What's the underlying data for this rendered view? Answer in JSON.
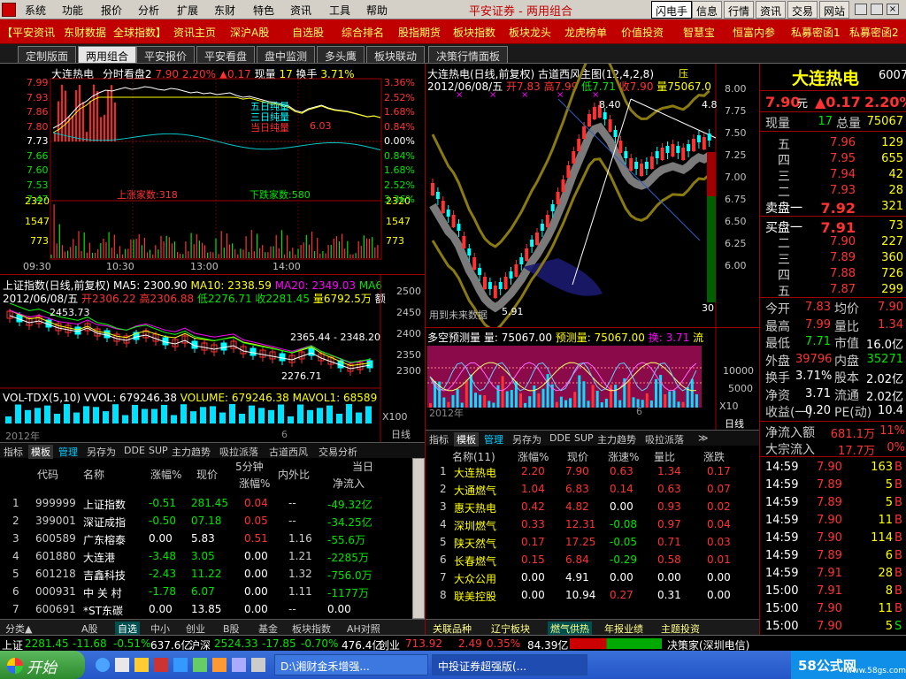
{
  "menu": {
    "items": [
      "系统",
      "功能",
      "报价",
      "分析",
      "扩展",
      "东财",
      "特色",
      "资讯",
      "工具",
      "帮助"
    ],
    "title_text": "平安证券 - 两用组合",
    "right_buttons": [
      "闪电手",
      "信息",
      "行情",
      "资讯",
      "交易",
      "网站"
    ],
    "watermark": "www.55188.com"
  },
  "linkbar": {
    "items": [
      "【平安资讯",
      "东财数据",
      "全球指数】",
      "资讯主页",
      "深沪A股",
      "自选股",
      "综合排名",
      "股指期货",
      "板块指数",
      "板块龙头",
      "龙虎榜单",
      "价值投资",
      "智慧宝",
      "恒富内参",
      "私募密函1",
      "私募密函2"
    ]
  },
  "viewtabs": [
    "定制版面",
    "两用组合",
    "平安报价",
    "平安看盘",
    "盘中监测",
    "多头鹰",
    "板块联动",
    "决策行情面板"
  ],
  "intraday": {
    "header": {
      "name": "大连热电",
      "mode": "分时看盘2",
      "price": "7.90",
      "pct": "2.20%",
      "chg": "▲0.17",
      "vol_lbl": "现量",
      "vol": "17",
      "turn_lbl": "换手",
      "turn": "3.71%"
    },
    "price_axis": [
      "7.99",
      "7.93",
      "7.86",
      "7.80",
      "7.73",
      "7.66",
      "7.60",
      "7.53",
      "7.47"
    ],
    "pct_axis": [
      "3.36%",
      "2.52%",
      "1.68%",
      "0.84%",
      "0.00%",
      "0.84%",
      "1.68%",
      "2.52%",
      "3.36%"
    ],
    "net_labels": [
      "五日纯量",
      "三日纯量",
      "当日纯量",
      "6.03"
    ],
    "up_count": "上涨家数:318",
    "down_count": "下跌家数:580",
    "vol_axis": [
      "2320",
      "1547",
      "773"
    ],
    "time_axis": [
      "09:30",
      "10:30",
      "13:00",
      "14:00"
    ]
  },
  "index_chart": {
    "header": {
      "name": "上证指数(日线,前复权)",
      "ma5": "MA5: 2300.90",
      "ma10": "MA10: 2338.59",
      "ma20": "MA20: 2349.03",
      "ma6": "MA6"
    },
    "header2": {
      "date": "2012/06/08/五",
      "open": "开2306.22",
      "high": "高2306.88",
      "low": "低2276.71",
      "close": "收2281.45",
      "amount": "量6792.5万",
      "unit": "额"
    },
    "axis": [
      "2500",
      "2450",
      "2400",
      "2350",
      "2300"
    ],
    "annot_top": "2453.73",
    "annot_mid": "2365.44 - 2348.20",
    "annot_low": "2276.71",
    "vol_header": {
      "name": "VOL-TDX(5,10)",
      "vvol": "VVOL: 679246.38",
      "volume": "VOLUME: 679246.38",
      "mavol": "MAVOL1: 68589"
    },
    "x100": "X100",
    "year": "2012年",
    "month": "6",
    "period": "日线"
  },
  "kline": {
    "header": {
      "name": "大连热电(日线,前复权)",
      "ind": "古道西风主图(12,4,2,8)",
      "pressure": "压"
    },
    "header2": {
      "date": "2012/06/08/五",
      "open": "开7.83",
      "high": "高7.99",
      "low": "低7.71",
      "close": "收7.90",
      "amount": "量75067.0"
    },
    "axis": [
      "8.00",
      "7.75",
      "7.50",
      "7.25",
      "7.00",
      "6.75",
      "6.50",
      "6.25",
      "6.00"
    ],
    "annot_high": "8.40",
    "annot_low": "5.91",
    "annot_r": "4.8",
    "future_label": "用到未来数据",
    "axis_30": "30"
  },
  "predict": {
    "header": {
      "name": "多空预测量",
      "amount": "量: 75067.00",
      "pred": "预测量: 75067.00",
      "swap": "换: 3.71",
      "flow": "流"
    },
    "axis": [
      "10000",
      "5000"
    ],
    "x10": "X10",
    "year": "2012年",
    "month": "6",
    "period": "日线"
  },
  "left_list": {
    "tabs": [
      "指标",
      "模板",
      "管理",
      "另存为",
      "DDE",
      "SUP",
      "主力趋势",
      "吸拉派落",
      "古道西风",
      "交易分析"
    ],
    "headers": [
      "代码",
      "名称",
      "涨幅%",
      "现价",
      "5分钟",
      "涨幅%",
      "内外比",
      "当日",
      "净流入"
    ],
    "rows": [
      {
        "no": "1",
        "code": "999999",
        "name": "上证指数",
        "pct": "-0.51",
        "price": "281.45",
        "m5": "0.04",
        "io": "--",
        "flow": "-49.32亿",
        "pc": "green",
        "fc": "green",
        "mc": "red"
      },
      {
        "no": "2",
        "code": "399001",
        "name": "深证成指",
        "pct": "-0.50",
        "price": "07.18",
        "m5": "0.05",
        "io": "--",
        "flow": "-34.25亿",
        "pc": "green",
        "fc": "green",
        "mc": "red"
      },
      {
        "no": "3",
        "code": "600589",
        "name": "广东榕泰",
        "pct": "0.00",
        "price": "5.83",
        "m5": "0.51",
        "io": "1.16",
        "flow": "-55.6万",
        "pc": "white",
        "fc": "green",
        "mc": "red"
      },
      {
        "no": "4",
        "code": "601880",
        "name": "大连港",
        "pct": "-3.48",
        "price": "3.05",
        "m5": "0.00",
        "io": "1.21",
        "flow": "-2285万",
        "pc": "green",
        "fc": "green",
        "mc": "white"
      },
      {
        "no": "5",
        "code": "601218",
        "name": "吉鑫科技",
        "pct": "-2.43",
        "price": "11.22",
        "m5": "0.00",
        "io": "1.32",
        "flow": "-756.0万",
        "pc": "green",
        "fc": "green",
        "mc": "white"
      },
      {
        "no": "6",
        "code": "000931",
        "name": "中 关 村",
        "pct": "-1.78",
        "price": "6.07",
        "m5": "0.00",
        "io": "1.11",
        "flow": "-1177万",
        "pc": "green",
        "fc": "green",
        "mc": "white"
      },
      {
        "no": "7",
        "code": "600691",
        "name": "*ST东碳",
        "pct": "0.00",
        "price": "13.85",
        "m5": "0.00",
        "io": "--",
        "flow": "0.00",
        "pc": "white",
        "fc": "white",
        "mc": "white"
      }
    ],
    "bottom_tabs": [
      "分类▲",
      "A股",
      "自选",
      "中小",
      "创业",
      "B股",
      "基金",
      "板块指数",
      "AH对照"
    ]
  },
  "mid_list": {
    "tabs": [
      "指标",
      "模板",
      "管理",
      "另存为",
      "DDE",
      "SUP",
      "主力趋势",
      "吸拉派落",
      "≫"
    ],
    "headers": [
      "名称(11)",
      "涨幅%",
      "现价",
      "涨速%",
      "量比",
      "涨跌"
    ],
    "rows": [
      {
        "no": "1",
        "name": "大连热电",
        "pct": "2.20",
        "price": "7.90",
        "spd": "0.63",
        "qr": "1.34",
        "chg": "0.17",
        "c": "red",
        "sc": "red"
      },
      {
        "no": "2",
        "name": "大通燃气",
        "pct": "1.04",
        "price": "6.83",
        "spd": "0.14",
        "qr": "0.63",
        "chg": "0.07",
        "c": "red",
        "sc": "red"
      },
      {
        "no": "3",
        "name": "惠天热电",
        "pct": "0.42",
        "price": "4.82",
        "spd": "0.00",
        "qr": "0.93",
        "chg": "0.02",
        "c": "red",
        "sc": "white"
      },
      {
        "no": "4",
        "name": "深圳燃气",
        "pct": "0.33",
        "price": "12.31",
        "spd": "-0.08",
        "qr": "0.97",
        "chg": "0.04",
        "c": "red",
        "sc": "green"
      },
      {
        "no": "5",
        "name": "陕天然气",
        "pct": "0.17",
        "price": "17.25",
        "spd": "-0.05",
        "qr": "0.71",
        "chg": "0.03",
        "c": "red",
        "sc": "green"
      },
      {
        "no": "6",
        "name": "长春燃气",
        "pct": "0.15",
        "price": "6.84",
        "spd": "-0.29",
        "qr": "0.58",
        "chg": "0.01",
        "c": "red",
        "sc": "green"
      },
      {
        "no": "7",
        "name": "大众公用",
        "pct": "0.00",
        "price": "4.91",
        "spd": "0.00",
        "qr": "0.00",
        "chg": "0.00",
        "c": "white",
        "sc": "white"
      },
      {
        "no": "8",
        "name": "联美控股",
        "pct": "0.00",
        "price": "10.94",
        "spd": "0.27",
        "qr": "0.31",
        "chg": "0.00",
        "c": "white",
        "sc": "red"
      }
    ],
    "bottom_tabs": [
      "关联品种",
      "辽宁板块",
      "燃气供热",
      "年报业绩",
      "主题投资"
    ]
  },
  "quote": {
    "name": "大连热电",
    "code": "6007",
    "price": "7.90",
    "yuan": "元",
    "chg": "▲0.17",
    "pct": "2.20%",
    "vol_now_lbl": "现量",
    "vol_now": "17",
    "vol_total_lbl": "总量",
    "vol_total": "75067",
    "asks": [
      {
        "lbl": "五",
        "p": "7.96",
        "v": "129"
      },
      {
        "lbl": "四",
        "p": "7.95",
        "v": "655"
      },
      {
        "lbl": "三",
        "p": "7.94",
        "v": "42"
      },
      {
        "lbl": "二",
        "p": "7.93",
        "v": "28"
      },
      {
        "lbl": "卖盘一",
        "p": "7.92",
        "v": "321"
      }
    ],
    "bids": [
      {
        "lbl": "买盘一",
        "p": "7.91",
        "v": "73"
      },
      {
        "lbl": "二",
        "p": "7.90",
        "v": "227"
      },
      {
        "lbl": "三",
        "p": "7.89",
        "v": "360"
      },
      {
        "lbl": "四",
        "p": "7.88",
        "v": "726"
      },
      {
        "lbl": "五",
        "p": "7.87",
        "v": "299"
      }
    ],
    "stats": [
      {
        "k1": "今开",
        "v1": "7.83",
        "c1": "red",
        "k2": "均价",
        "v2": "7.90",
        "c2": "red"
      },
      {
        "k1": "最高",
        "v1": "7.99",
        "c1": "red",
        "k2": "量比",
        "v2": "1.34",
        "c2": "red"
      },
      {
        "k1": "最低",
        "v1": "7.71",
        "c1": "green",
        "k2": "市值",
        "v2": "16.0亿",
        "c2": "white"
      },
      {
        "k1": "外盘",
        "v1": "39796",
        "c1": "red",
        "k2": "内盘",
        "v2": "35271",
        "c2": "green"
      },
      {
        "k1": "换手",
        "v1": "3.71%",
        "c1": "white",
        "k2": "股本",
        "v2": "2.02亿",
        "c2": "white"
      },
      {
        "k1": "净资",
        "v1": "3.71",
        "c1": "white",
        "k2": "流通",
        "v2": "2.02亿",
        "c2": "white"
      },
      {
        "k1": "收益(一)",
        "v1": "0.20",
        "c1": "white",
        "k2": "PE(动)",
        "v2": "10.4",
        "c2": "white"
      }
    ],
    "net_in_lbl": "净流入额",
    "net_in": "681.1万",
    "net_in_pct": "11%",
    "big_lbl": "大宗流入",
    "big": "17.7万",
    "big_pct": "0%",
    "ticks": [
      {
        "t": "14:59",
        "p": "7.90",
        "v": "163",
        "s": "B",
        "sc": "red"
      },
      {
        "t": "14:59",
        "p": "7.89",
        "v": "5",
        "s": "B",
        "sc": "red"
      },
      {
        "t": "14:59",
        "p": "7.89",
        "v": "5",
        "s": "B",
        "sc": "red"
      },
      {
        "t": "14:59",
        "p": "7.90",
        "v": "11",
        "s": "B",
        "sc": "red"
      },
      {
        "t": "14:59",
        "p": "7.90",
        "v": "114",
        "s": "B",
        "sc": "red"
      },
      {
        "t": "14:59",
        "p": "7.89",
        "v": "6",
        "s": "B",
        "sc": "red"
      },
      {
        "t": "14:59",
        "p": "7.91",
        "v": "28",
        "s": "B",
        "sc": "red"
      },
      {
        "t": "15:00",
        "p": "7.91",
        "v": "8",
        "s": "B",
        "sc": "red"
      },
      {
        "t": "15:00",
        "p": "7.90",
        "v": "11",
        "s": "B",
        "sc": "red"
      },
      {
        "t": "15:00",
        "p": "7.90",
        "v": "5",
        "s": "S",
        "sc": "green"
      }
    ]
  },
  "status": {
    "sh_lbl": "上证",
    "sh": "2281.45",
    "sh_chg": "-11.68",
    "sh_pct": "-0.51%",
    "sh_amt": "637.6亿",
    "sz_lbl": "沪深",
    "sz": "2524.33",
    "sz_chg": "-17.85",
    "sz_pct": "-0.70%",
    "sz_amt": "476.4亿",
    "cy_lbl": "创业",
    "cy": "713.92",
    "cy_chg": "2.49",
    "cy_pct": "0.35%",
    "cy_amt": "84.39亿",
    "decider": "决策家(深圳电信)"
  },
  "taskbar": {
    "start": "开始",
    "item1": "D:\\湘财金禾增强...",
    "item2": "中投证券超强版(...",
    "brand": "58公式网",
    "brand_url": "www.58gs.com"
  }
}
